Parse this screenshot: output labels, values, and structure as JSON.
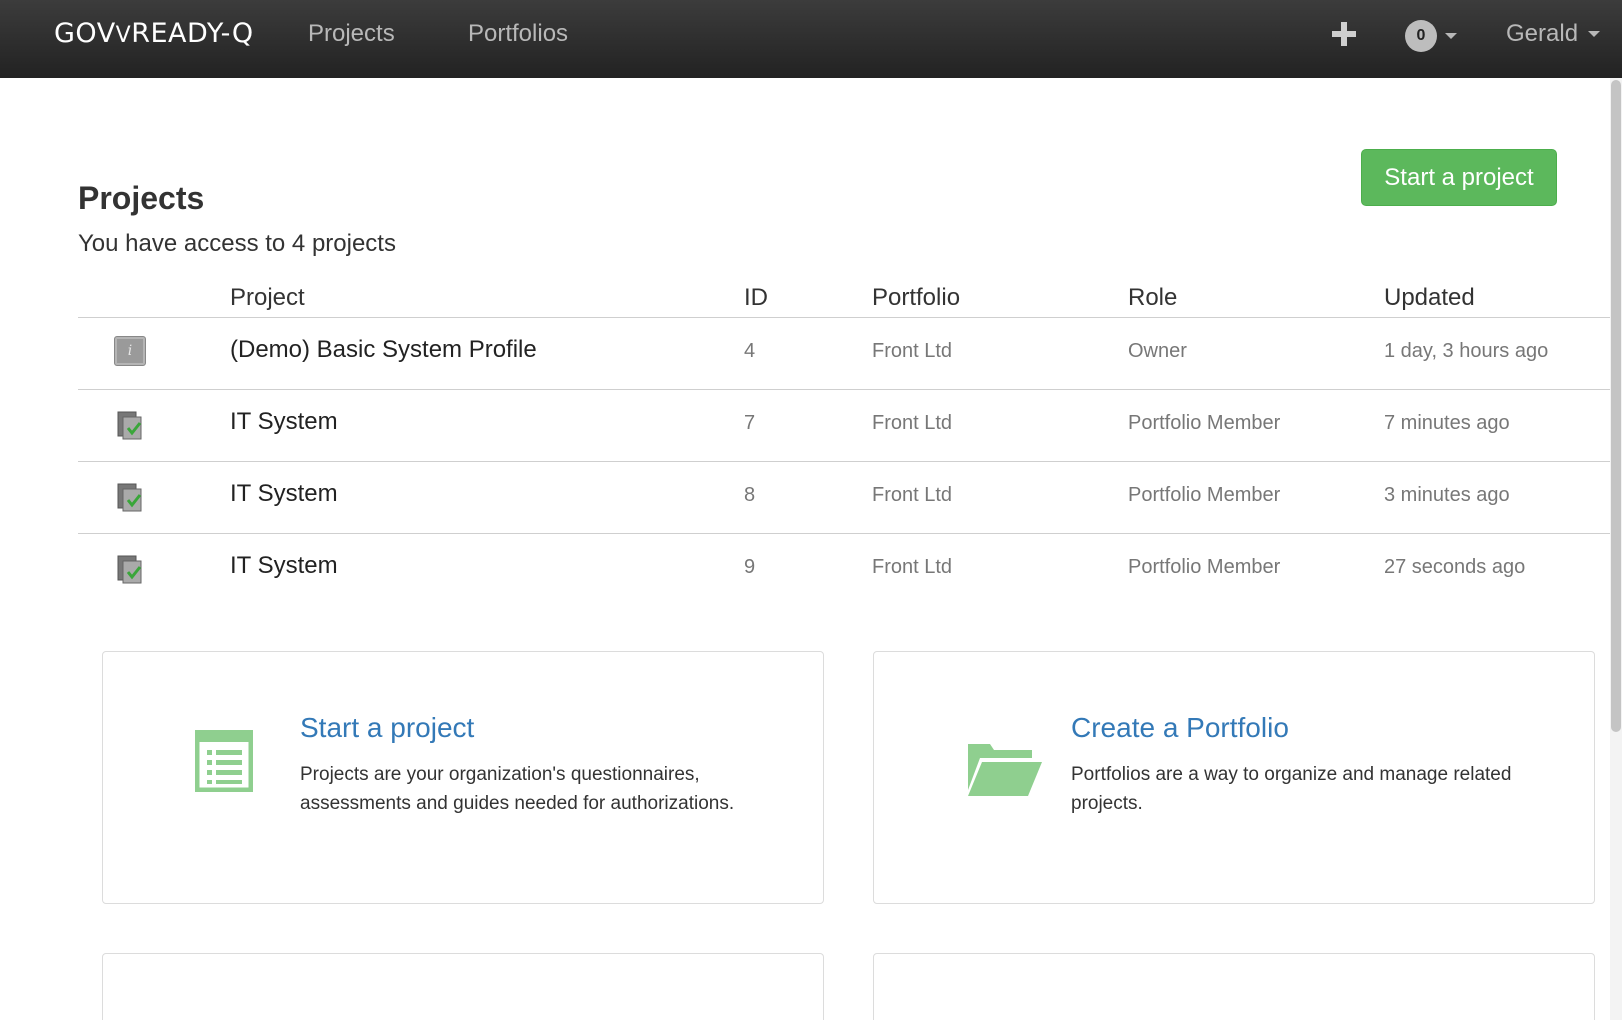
{
  "navbar": {
    "brand_prefix": "GOV",
    "brand_v": "V",
    "brand_suffix": "READY-Q",
    "links": [
      "Projects",
      "Portfolios"
    ],
    "notification_count": "0",
    "user_name": "Gerald"
  },
  "header": {
    "title": "Projects",
    "subtitle": "You have access to 4 projects",
    "start_button": "Start a project"
  },
  "table": {
    "columns": [
      "Project",
      "ID",
      "Portfolio",
      "Role",
      "Updated"
    ],
    "rows": [
      {
        "icon": "info-icon",
        "name": "(Demo) Basic System Profile",
        "id": "4",
        "portfolio": "Front Ltd",
        "role": "Owner",
        "updated": "1 day, 3 hours ago"
      },
      {
        "icon": "document-check-icon",
        "name": "IT System",
        "id": "7",
        "portfolio": "Front Ltd",
        "role": "Portfolio Member",
        "updated": "7 minutes ago"
      },
      {
        "icon": "document-check-icon",
        "name": "IT System",
        "id": "8",
        "portfolio": "Front Ltd",
        "role": "Portfolio Member",
        "updated": "3 minutes ago"
      },
      {
        "icon": "document-check-icon",
        "name": "IT System",
        "id": "9",
        "portfolio": "Front Ltd",
        "role": "Portfolio Member",
        "updated": "27 seconds ago"
      }
    ]
  },
  "cards": [
    {
      "icon": "list-icon",
      "title": "Start a project",
      "text": "Projects are your organization's questionnaires, assessments and guides needed for authorizations."
    },
    {
      "icon": "folder-open-icon",
      "title": "Create a Portfolio",
      "text": "Portfolios are a way to organize and manage related projects."
    }
  ],
  "colors": {
    "navbar": "#2b2b2b",
    "accent_green": "#5cb85c",
    "link_blue": "#3379b7",
    "icon_green": "#8fcf8f"
  }
}
